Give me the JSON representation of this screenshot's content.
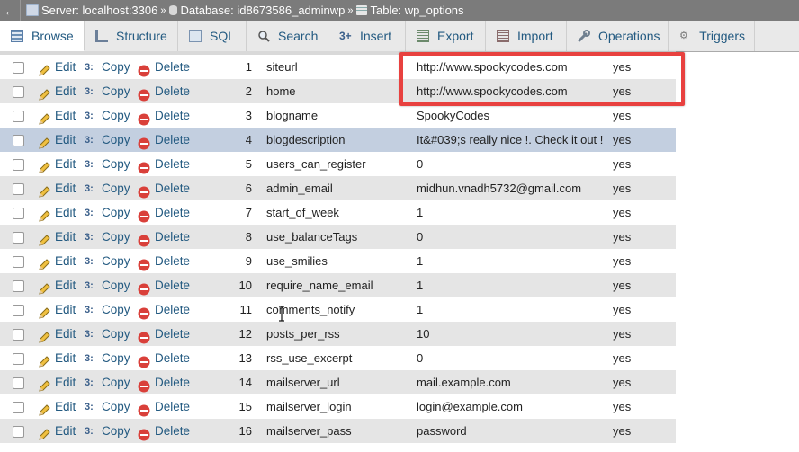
{
  "breadcrumb": {
    "server": "Server: localhost:3306",
    "database": "Database: id8673586_adminwp",
    "table": "Table: wp_options",
    "separator": "»"
  },
  "tabs": [
    {
      "label": "Browse",
      "icon": "browse-icon",
      "active": true
    },
    {
      "label": "Structure",
      "icon": "structure-icon"
    },
    {
      "label": "SQL",
      "icon": "sql-icon"
    },
    {
      "label": "Search",
      "icon": "search-icon"
    },
    {
      "label": "Insert",
      "icon": "insert-icon"
    },
    {
      "label": "Export",
      "icon": "export-icon"
    },
    {
      "label": "Import",
      "icon": "import-icon"
    },
    {
      "label": "Operations",
      "icon": "wrench-icon"
    },
    {
      "label": "Triggers",
      "icon": "triggers-icon"
    }
  ],
  "actions": {
    "edit": "Edit",
    "copy": "Copy",
    "delete": "Delete"
  },
  "rows": [
    {
      "id": "1",
      "name": "siteurl",
      "value": "http://www.spookycodes.com",
      "autoload": "yes"
    },
    {
      "id": "2",
      "name": "home",
      "value": "http://www.spookycodes.com",
      "autoload": "yes"
    },
    {
      "id": "3",
      "name": "blogname",
      "value": "SpookyCodes",
      "autoload": "yes"
    },
    {
      "id": "4",
      "name": "blogdescription",
      "value": "It&#039;s really nice !. Check it out !",
      "autoload": "yes"
    },
    {
      "id": "5",
      "name": "users_can_register",
      "value": "0",
      "autoload": "yes"
    },
    {
      "id": "6",
      "name": "admin_email",
      "value": "midhun.vnadh5732@gmail.com",
      "autoload": "yes"
    },
    {
      "id": "7",
      "name": "start_of_week",
      "value": "1",
      "autoload": "yes"
    },
    {
      "id": "8",
      "name": "use_balanceTags",
      "value": "0",
      "autoload": "yes"
    },
    {
      "id": "9",
      "name": "use_smilies",
      "value": "1",
      "autoload": "yes"
    },
    {
      "id": "10",
      "name": "require_name_email",
      "value": "1",
      "autoload": "yes"
    },
    {
      "id": "11",
      "name": "comments_notify",
      "value": "1",
      "autoload": "yes"
    },
    {
      "id": "12",
      "name": "posts_per_rss",
      "value": "10",
      "autoload": "yes"
    },
    {
      "id": "13",
      "name": "rss_use_excerpt",
      "value": "0",
      "autoload": "yes"
    },
    {
      "id": "14",
      "name": "mailserver_url",
      "value": "mail.example.com",
      "autoload": "yes"
    },
    {
      "id": "15",
      "name": "mailserver_login",
      "value": "login@example.com",
      "autoload": "yes"
    },
    {
      "id": "16",
      "name": "mailserver_pass",
      "value": "password",
      "autoload": "yes"
    }
  ],
  "highlighted_row": "4",
  "colors": {
    "link": "#235a81",
    "highlight": "#c3cfe0",
    "annotation": "#e8413f"
  }
}
